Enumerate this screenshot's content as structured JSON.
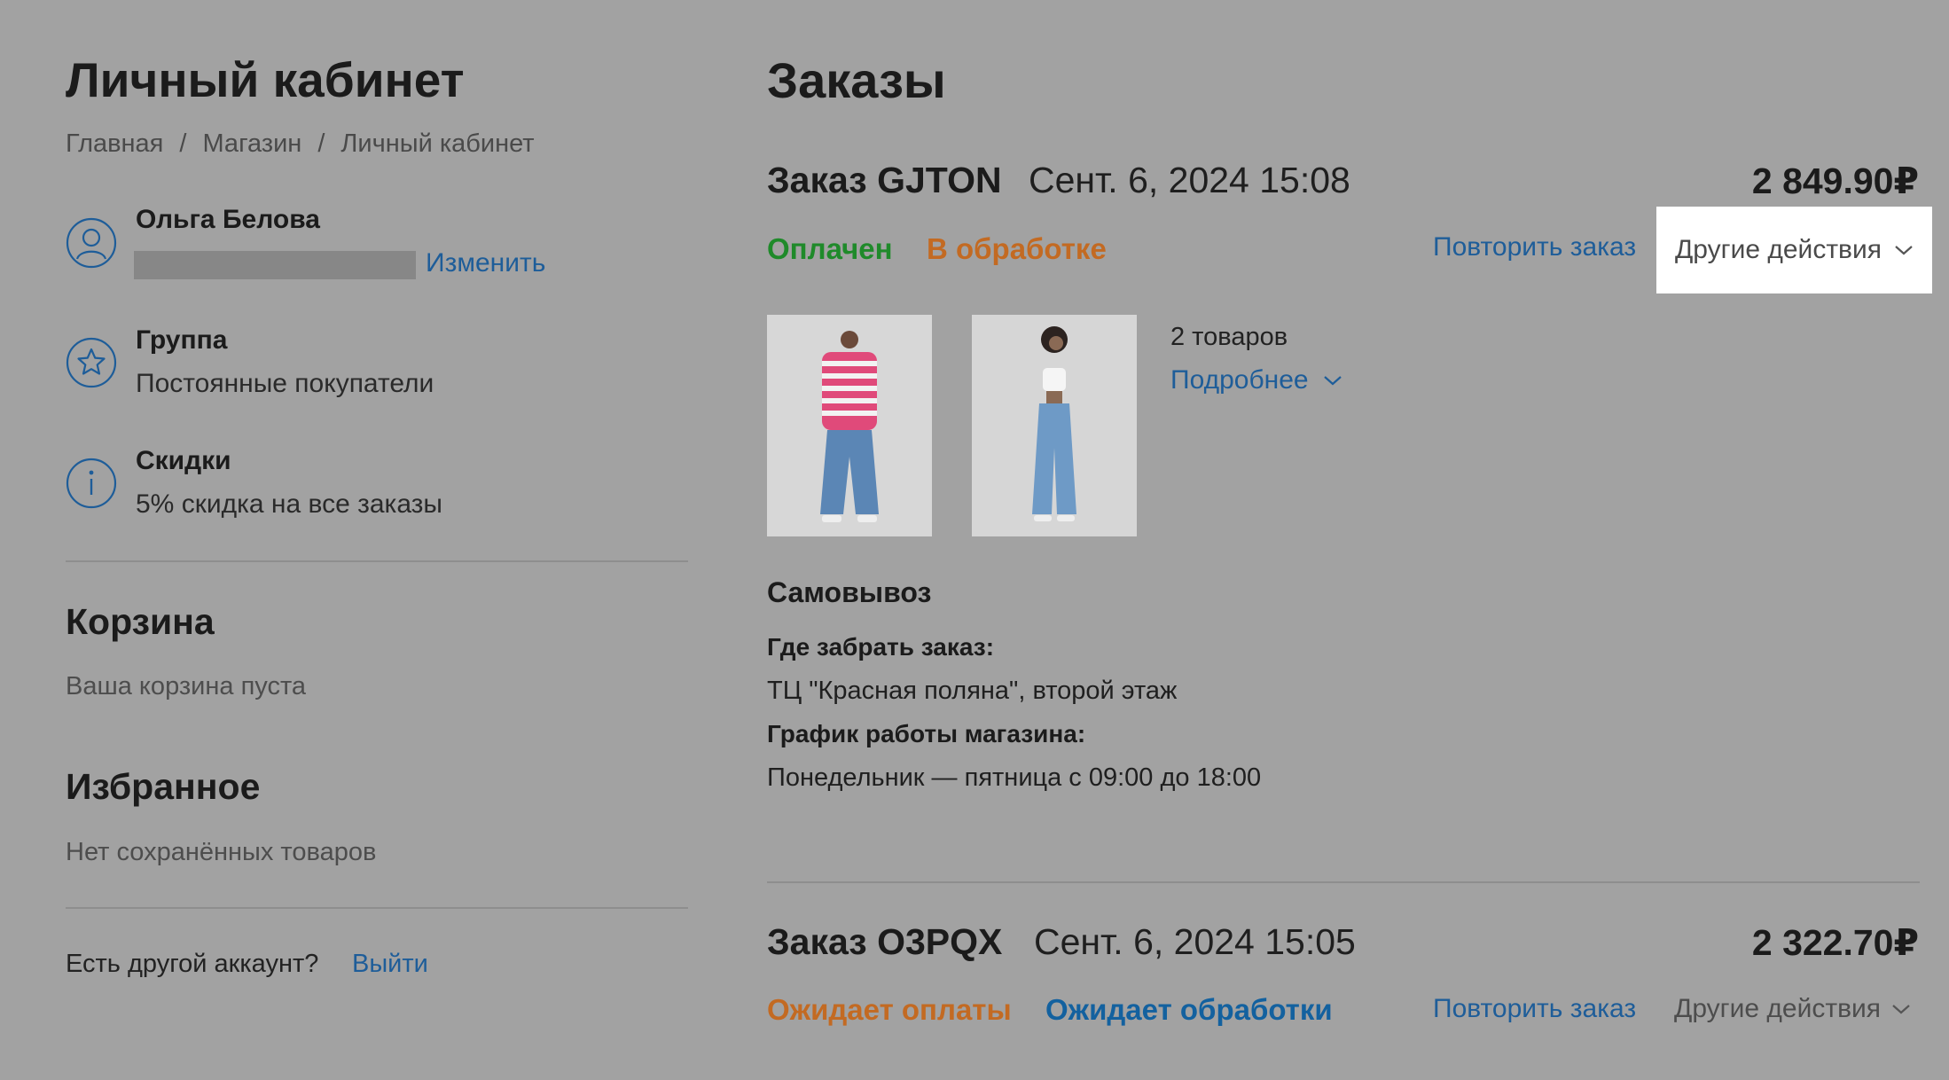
{
  "sidebar": {
    "title": "Личный кабинет",
    "breadcrumb": [
      "Главная",
      "Магазин",
      "Личный кабинет"
    ],
    "user": {
      "name": "Ольга Белова",
      "edit_label": "Изменить",
      "icon": "user-icon"
    },
    "group": {
      "title": "Группа",
      "value": "Постоянные покупатели",
      "icon": "star-icon"
    },
    "discounts": {
      "title": "Скидки",
      "value": "5% скидка на все заказы",
      "icon": "info-icon"
    },
    "cart": {
      "title": "Корзина",
      "empty_text": "Ваша корзина пуста"
    },
    "favorites": {
      "title": "Избранное",
      "empty_text": "Нет сохранённых товаров"
    },
    "account": {
      "question": "Есть другой аккаунт?",
      "logout_label": "Выйти"
    }
  },
  "orders": {
    "title": "Заказы",
    "list": [
      {
        "number": "Заказ GJTON",
        "date": "Сент. 6, 2024 15:08",
        "total": "2 849.90₽",
        "statuses": [
          "Оплачен",
          "В обработке"
        ],
        "repeat_label": "Повторить заказ",
        "actions_label": "Другие действия",
        "items_count": "2 товаров",
        "details_label": "Подробнее",
        "delivery": {
          "method": "Самовывоз",
          "where_label": "Где забрать заказ:",
          "where_value": "ТЦ \"Красная поляна\", второй этаж",
          "schedule_label": "График работы магазина:",
          "schedule_value": "Понедельник — пятница с 09:00 до 18:00"
        }
      },
      {
        "number": "Заказ O3PQX",
        "date": "Сент. 6, 2024 15:05",
        "total": "2 322.70₽",
        "statuses": [
          "Ожидает оплаты",
          "Ожидает обработки"
        ],
        "repeat_label": "Повторить заказ",
        "actions_label": "Другие действия"
      }
    ]
  },
  "colors": {
    "background": "#a2a2a2",
    "link": "#1e5d99",
    "status_paid": "#1f8a2a",
    "status_processing": "#c36a22",
    "status_awaiting_processing": "#13619f"
  }
}
